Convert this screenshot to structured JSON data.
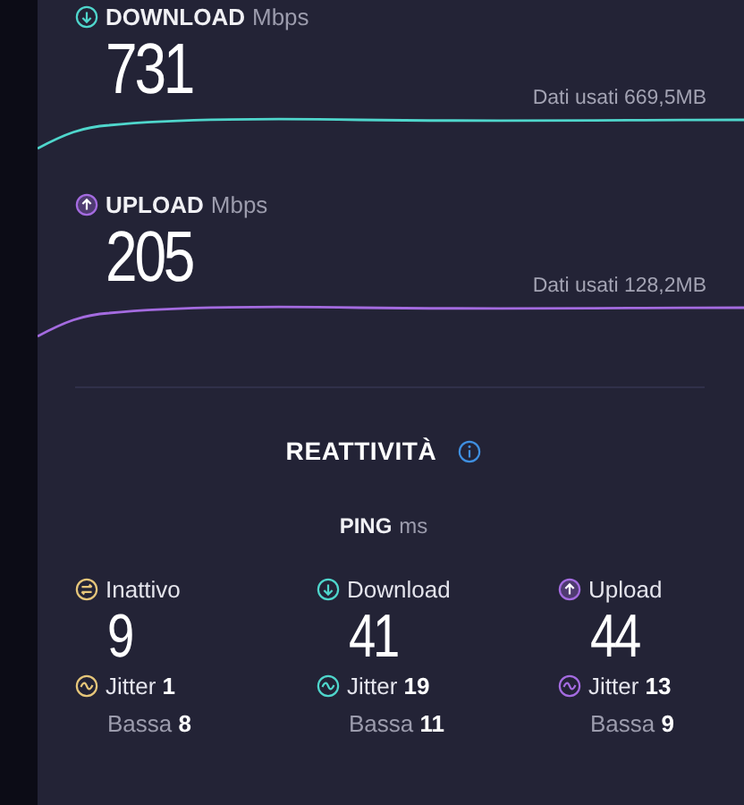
{
  "speeds": [
    {
      "kind": "download",
      "label": "DOWNLOAD",
      "unit": "Mbps",
      "value": "731",
      "data_used": "Dati usati 669,5MB",
      "color": "#4fd6cc"
    },
    {
      "kind": "upload",
      "label": "UPLOAD",
      "unit": "Mbps",
      "value": "205",
      "data_used": "Dati usati 128,2MB",
      "color": "#a46be0"
    }
  ],
  "responsiveness": {
    "title": "REATTIVITÀ",
    "ping_label": "PING",
    "ping_unit": "ms",
    "columns": [
      {
        "kind": "idle",
        "label": "Inattivo",
        "value": "9",
        "jitter": "Jitter **1**",
        "low": "Bassa **8**",
        "color": "#e6c67a"
      },
      {
        "kind": "download",
        "label": "Download",
        "value": "41",
        "jitter": "Jitter **19**",
        "low": "Bassa **11**",
        "color": "#4fd6cc"
      },
      {
        "kind": "upload",
        "label": "Upload",
        "value": "44",
        "jitter": "Jitter **13**",
        "low": "Bassa **9**",
        "color": "#a46be0"
      }
    ]
  }
}
